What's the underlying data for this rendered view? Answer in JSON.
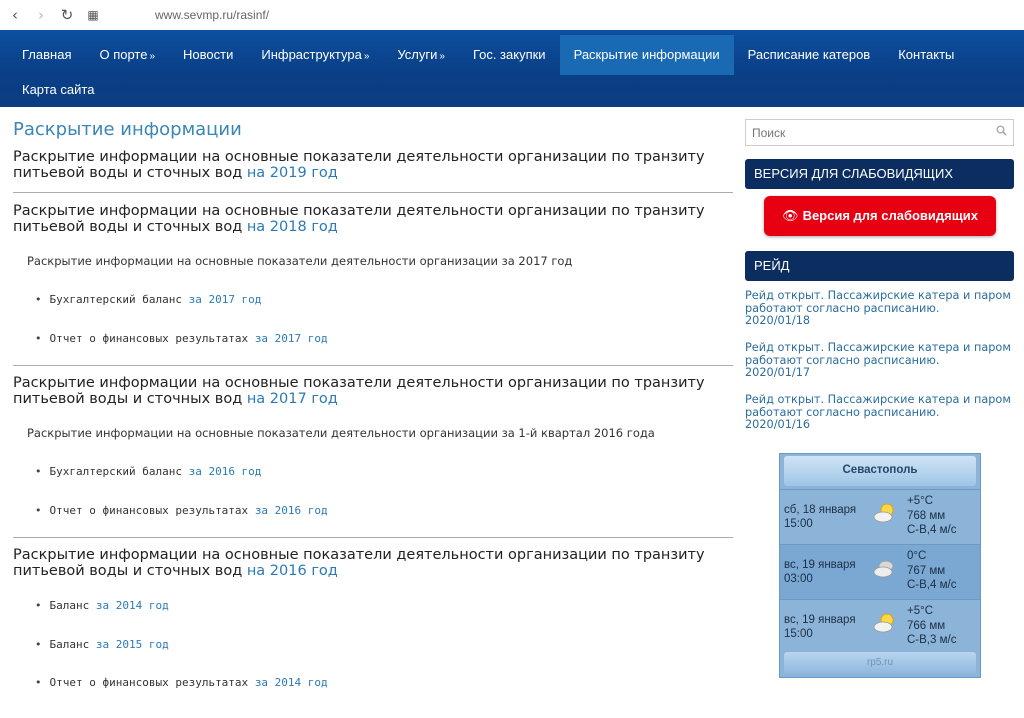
{
  "browser": {
    "url": "www.sevmp.ru/rasinf/"
  },
  "nav": {
    "row1": [
      {
        "label": "Главная",
        "arrow": ""
      },
      {
        "label": "О порте",
        "arrow": "»"
      },
      {
        "label": "Новости",
        "arrow": ""
      },
      {
        "label": "Инфраструктура",
        "arrow": "»"
      },
      {
        "label": "Услуги",
        "arrow": "»"
      },
      {
        "label": "Гос. закупки",
        "arrow": ""
      },
      {
        "label": "Раскрытие информации",
        "arrow": "",
        "active": true
      },
      {
        "label": "Расписание катеров",
        "arrow": ""
      },
      {
        "label": "Контакты",
        "arrow": ""
      }
    ],
    "row2": [
      {
        "label": "Карта сайта",
        "arrow": ""
      }
    ]
  },
  "main": {
    "title": "Раскрытие информации",
    "sections": [
      {
        "title_text": "Раскрытие информации на основные показатели деятельности организации по транзиту питьевой воды и сточных вод",
        "year_link": "на 2019 год"
      },
      {
        "title_text": "Раскрытие информации на основные показатели деятельности организации по транзиту питьевой воды и сточных вод",
        "year_link": "на 2018 год",
        "subtitle": "Раскрытие информации на основные показатели деятельности организации за 2017 год",
        "items": [
          {
            "text": "Бухгалтерский баланс",
            "link": "за 2017 год"
          },
          {
            "text": "Отчет о финансовых результатах",
            "link": "за 2017 год"
          }
        ]
      },
      {
        "title_text": "Раскрытие информации на основные показатели деятельности организации по транзиту питьевой воды и сточных вод",
        "year_link": "на 2017 год",
        "subtitle": "Раскрытие информации на основные показатели деятельности организации за 1-й квартал 2016 года",
        "items": [
          {
            "text": "Бухгалтерский баланс",
            "link": "за 2016 год"
          },
          {
            "text": "Отчет о финансовых результатах",
            "link": "за 2016 год"
          }
        ]
      },
      {
        "title_text": "Раскрытие информации на основные показатели деятельности организации по транзиту питьевой воды и сточных вод",
        "year_link": "на 2016 год",
        "items": [
          {
            "text": "Баланс",
            "link": "за 2014 год"
          },
          {
            "text": "Баланс",
            "link": "за 2015 год"
          },
          {
            "text": "Отчет о финансовых результатах",
            "link": "за 2014 год"
          }
        ]
      }
    ]
  },
  "sidebar": {
    "search_placeholder": "Поиск",
    "vi_heading": "ВЕРСИЯ ДЛЯ СЛАБОВИДЯЩИХ",
    "vi_button": "Версия для слабовидящих",
    "raid_heading": "РЕЙД",
    "news": [
      {
        "text": "Рейд открыт. Пассажирские катера и паром работают согласно расписанию.",
        "date": "2020/01/18"
      },
      {
        "text": "Рейд открыт. Пассажирские катера и паром работают согласно расписанию.",
        "date": "2020/01/17"
      },
      {
        "text": "Рейд открыт. Пассажирские катера и паром работают согласно расписанию.",
        "date": "2020/01/16"
      }
    ],
    "weather": {
      "city": "Севастополь",
      "rows": [
        {
          "day": "сб, 18 января",
          "time": "15:00",
          "temp": "+5°C",
          "pressure": "768 мм",
          "wind": "С-В,4 м/с",
          "icon": "partly-cloudy-icon"
        },
        {
          "day": "вс, 19 января",
          "time": "03:00",
          "temp": "0°C",
          "pressure": "767 мм",
          "wind": "С-В,4 м/с",
          "icon": "cloudy-night-icon"
        },
        {
          "day": "вс, 19 января",
          "time": "15:00",
          "temp": "+5°C",
          "pressure": "766 мм",
          "wind": "С-В,3 м/с",
          "icon": "partly-cloudy-icon"
        }
      ],
      "footer": "rp5.ru"
    }
  }
}
